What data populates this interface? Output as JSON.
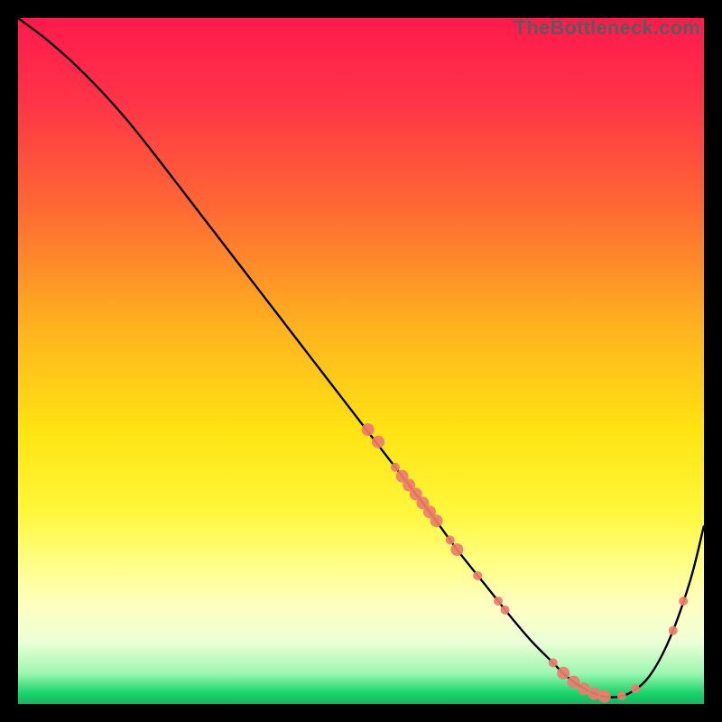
{
  "watermark": "TheBottleneck.com",
  "chart_data": {
    "type": "line",
    "title": "",
    "xlabel": "",
    "ylabel": "",
    "xlim": [
      0,
      100
    ],
    "ylim": [
      0,
      100
    ],
    "grid": false,
    "legend": false,
    "background_gradient": {
      "stops": [
        {
          "offset": 0.0,
          "color": "#ff1a4d"
        },
        {
          "offset": 0.12,
          "color": "#ff3348"
        },
        {
          "offset": 0.28,
          "color": "#ff6a33"
        },
        {
          "offset": 0.45,
          "color": "#ffb21f"
        },
        {
          "offset": 0.6,
          "color": "#ffe312"
        },
        {
          "offset": 0.72,
          "color": "#fff73a"
        },
        {
          "offset": 0.8,
          "color": "#ffff8a"
        },
        {
          "offset": 0.86,
          "color": "#fdffc3"
        },
        {
          "offset": 0.91,
          "color": "#ecffd6"
        },
        {
          "offset": 0.955,
          "color": "#9df7b0"
        },
        {
          "offset": 0.985,
          "color": "#17d36a"
        },
        {
          "offset": 1.0,
          "color": "#0fba5c"
        }
      ]
    },
    "series": [
      {
        "name": "bottleneck-curve",
        "color": "#000000",
        "x": [
          0,
          4,
          8,
          12,
          16,
          20,
          25,
          30,
          35,
          40,
          45,
          50,
          55,
          60,
          64,
          68,
          72,
          75,
          78,
          80,
          83,
          86,
          89,
          92,
          95,
          98,
          100
        ],
        "y": [
          100,
          97,
          93.5,
          89.5,
          85,
          80,
          73.5,
          67,
          60.5,
          54,
          47.5,
          41,
          34.5,
          28,
          22.5,
          17.5,
          12.5,
          9,
          6,
          4,
          2,
          1,
          1.5,
          4,
          9.5,
          18,
          26
        ]
      }
    ],
    "markers": {
      "name": "highlight-points",
      "color": "#ef7b6f",
      "radius_small": 5,
      "radius_medium": 7,
      "points": [
        {
          "x": 51,
          "y": 40.0,
          "r": "medium"
        },
        {
          "x": 52.5,
          "y": 38.2,
          "r": "medium"
        },
        {
          "x": 55,
          "y": 34.5,
          "r": "small"
        },
        {
          "x": 56,
          "y": 33.2,
          "r": "medium"
        },
        {
          "x": 57,
          "y": 31.9,
          "r": "medium"
        },
        {
          "x": 58,
          "y": 30.6,
          "r": "medium"
        },
        {
          "x": 59,
          "y": 29.3,
          "r": "medium"
        },
        {
          "x": 60,
          "y": 28.0,
          "r": "medium"
        },
        {
          "x": 61,
          "y": 26.7,
          "r": "medium"
        },
        {
          "x": 63,
          "y": 23.9,
          "r": "small"
        },
        {
          "x": 64,
          "y": 22.5,
          "r": "medium"
        },
        {
          "x": 67,
          "y": 18.7,
          "r": "small"
        },
        {
          "x": 70,
          "y": 15.0,
          "r": "small"
        },
        {
          "x": 71,
          "y": 13.7,
          "r": "small"
        },
        {
          "x": 78,
          "y": 6.0,
          "r": "small"
        },
        {
          "x": 79.5,
          "y": 4.5,
          "r": "medium"
        },
        {
          "x": 81,
          "y": 3.2,
          "r": "medium"
        },
        {
          "x": 82.5,
          "y": 2.2,
          "r": "medium"
        },
        {
          "x": 84,
          "y": 1.5,
          "r": "medium"
        },
        {
          "x": 85.5,
          "y": 1.1,
          "r": "medium"
        },
        {
          "x": 88,
          "y": 1.2,
          "r": "small"
        },
        {
          "x": 90,
          "y": 2.2,
          "r": "small"
        },
        {
          "x": 95.5,
          "y": 10.7,
          "r": "small"
        },
        {
          "x": 97,
          "y": 15.0,
          "r": "small"
        }
      ]
    }
  }
}
